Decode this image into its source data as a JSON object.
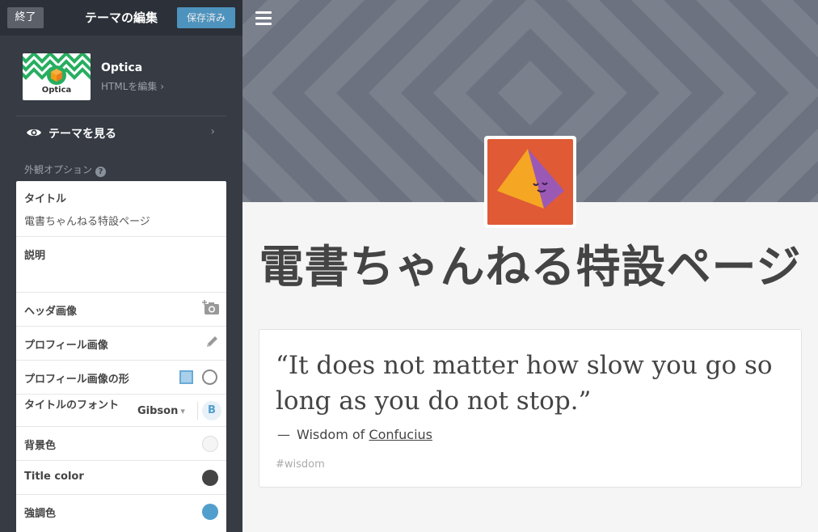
{
  "topbar": {
    "exit_label": "終了",
    "title": "テーマの編集",
    "saved_label": "保存済み"
  },
  "theme": {
    "name": "Optica",
    "edit_html": "HTMLを編集 ›",
    "thumb_label": "Optica"
  },
  "view_theme": {
    "label": "テーマを見る",
    "chevron": "›"
  },
  "appearance": {
    "label": "外観オプション",
    "help": "?"
  },
  "options": {
    "title_label": "タイトル",
    "title_value": "電書ちゃんねる特設ページ",
    "description_label": "説明",
    "header_image_label": "ヘッダ画像",
    "profile_image_label": "プロフィール画像",
    "profile_shape_label": "プロフィール画像の形",
    "title_font_label": "タイトルのフォント",
    "title_font_value": "Gibson",
    "bold_label": "B",
    "bg_color_label": "背景色",
    "title_color_label": "Title color",
    "accent_color_label": "強調色"
  },
  "colors": {
    "background": "#f5f5f5",
    "title": "#444444",
    "accent": "#529ecc",
    "sidebar": "#363b44",
    "avatar_bg": "#e05a35"
  },
  "blog": {
    "title": "電書ちゃんねる特設ページ"
  },
  "post": {
    "quote": "“It does not matter how slow you go so long as you do not stop.”",
    "source_dash": "—",
    "source_prefix": "Wisdom of",
    "source_link": "Confucius",
    "tag": "#wisdom"
  }
}
